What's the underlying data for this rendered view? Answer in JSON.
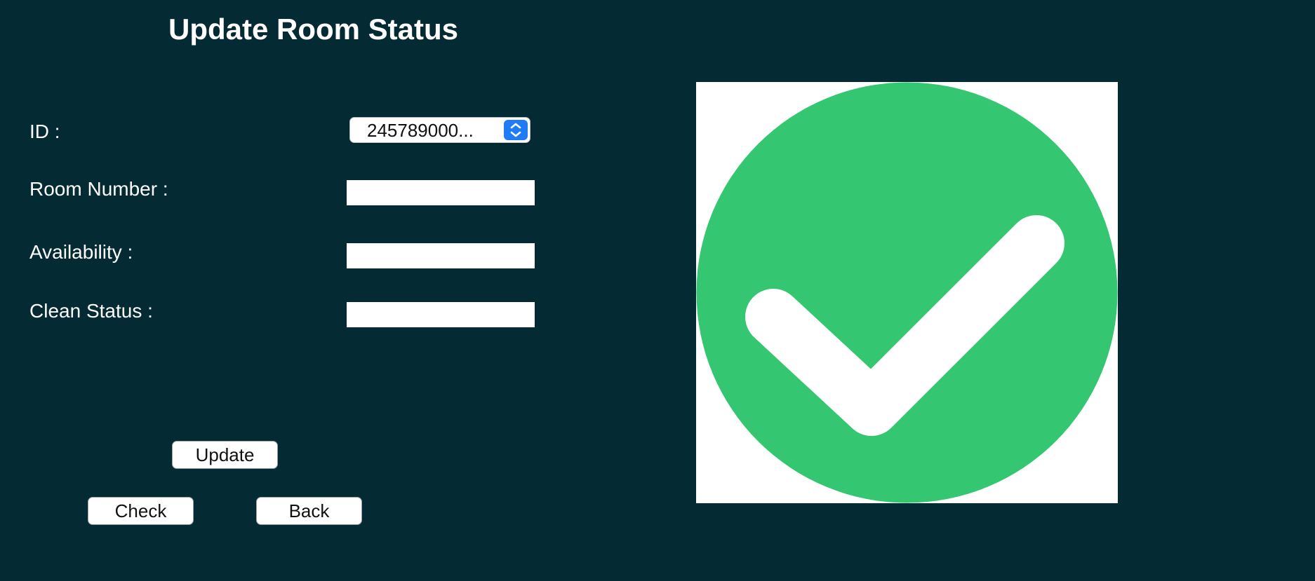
{
  "form": {
    "title": "Update Room Status",
    "id_label": "ID :",
    "id_selected": "245789000...",
    "room_number_label": "Room Number :",
    "room_number_value": "",
    "availability_label": "Availability :",
    "availability_value": "",
    "clean_status_label": "Clean Status :",
    "clean_status_value": ""
  },
  "buttons": {
    "update": "Update",
    "check": "Check",
    "back": "Back"
  },
  "status_image": {
    "icon": "check-circle-icon",
    "circle_color": "#34c671",
    "check_color": "#ffffff"
  },
  "colors": {
    "background": "#042b33",
    "accent": "#1f7cf6"
  }
}
